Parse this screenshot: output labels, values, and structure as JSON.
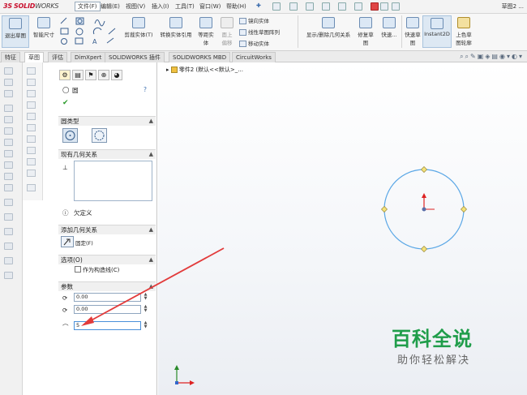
{
  "app": {
    "logo_ds": "3S",
    "logo_sw": "SOLID",
    "logo_works": "WORKS",
    "document_title": "草图2 ..."
  },
  "menu": [
    "文件(F)",
    "编辑(E)",
    "视图(V)",
    "插入(I)",
    "工具(T)",
    "窗口(W)",
    "帮助(H)"
  ],
  "ribbon": {
    "exit_sketch": "退出草图",
    "smart_dimension": "智能尺寸",
    "trim_entities": "剪裁实体(T)",
    "convert_entities": "转换实体引用",
    "offset_line1": "等距实",
    "offset_line2": "体",
    "surface_offset_line1": "面上",
    "surface_offset_line2": "偏移",
    "mirror_entities": "镜向实体",
    "linear_pattern": "线性草图阵列",
    "move_entities": "移动实体",
    "show_relations": "显示/删除几何关系",
    "repair_sketch_line1": "修复草",
    "repair_sketch_line2": "图",
    "quick_snap_line1": "快速...",
    "rapid_sketch_line1": "快速草",
    "rapid_sketch_line2": "图",
    "instant2d": "Instant2D",
    "shaded_contours_line1": "上色草",
    "shaded_contours_line2": "图轮廓"
  },
  "tabs": [
    "特征",
    "草图",
    "评估",
    "DimXpert",
    "SOLIDWORKS 插件",
    "SOLIDWORKS MBD",
    "CircuitWorks"
  ],
  "active_tab": 1,
  "property_manager": {
    "title": "圆",
    "circle_type_header": "圆类型",
    "existing_relations_header": "现有几何关系",
    "status_text": "欠定义",
    "add_relations_header": "添加几何关系",
    "fix_label": "固定(F)",
    "options_header": "选项(O)",
    "construction_label": "作为构造线(C)",
    "params_header": "参数",
    "cx_value": "0.00",
    "cy_value": "0.00",
    "radius_value": "5"
  },
  "tree": {
    "part_label": "零件2 (默认<<默认>_..."
  },
  "watermark": {
    "title": "百科全说",
    "subtitle": "助你轻松解决"
  },
  "colors": {
    "circle": "#5aa7e6",
    "arrow": "#e23b3b",
    "watermark_green": "#1f9d4a",
    "brand_red": "#c8102e"
  }
}
